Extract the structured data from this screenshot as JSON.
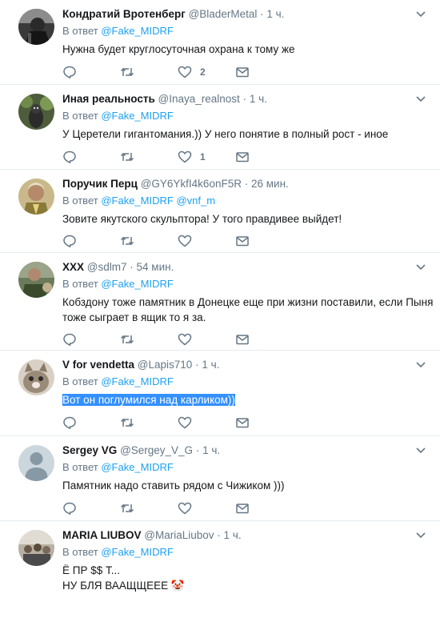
{
  "reply_prefix": "В ответ",
  "dot": "·",
  "tweets": [
    {
      "name": "Кондратий Вротенберг",
      "handle": "@BladerMetal",
      "time": "1 ч.",
      "reply_to": [
        "@Fake_MIDRF"
      ],
      "text": [
        "Нужна будет круглосуточная охрана к тому же"
      ],
      "likes": "2"
    },
    {
      "name": "Иная реальность",
      "handle": "@Inaya_realnost",
      "time": "1 ч.",
      "reply_to": [
        "@Fake_MIDRF"
      ],
      "text": [
        "У Церетели гигантомания.)) У него понятие в полный рост - иное"
      ],
      "likes": "1"
    },
    {
      "name": "Поручик Перц",
      "handle": "@GY6YkfI4k6onF5R",
      "time": "26 мин.",
      "reply_to": [
        "@Fake_MIDRF",
        "@vnf_m"
      ],
      "text": [
        "Зовите якутского скульптора! У того правдивее выйдет!"
      ],
      "likes": ""
    },
    {
      "name": "XXX",
      "handle": "@sdlm7",
      "time": "54 мин.",
      "reply_to": [
        "@Fake_MIDRF"
      ],
      "text": [
        "Кобздону тоже памятник в Донецке еще при жизни поставили, если Пыня",
        "тоже сыграет в ящик то я за."
      ],
      "likes": ""
    },
    {
      "name": "V for vendetta",
      "handle": "@Lapis710",
      "time": "1 ч.",
      "reply_to": [
        "@Fake_MIDRF"
      ],
      "text": [
        "Вот он поглумился над карликом))"
      ],
      "likes": ""
    },
    {
      "name": "Sergey VG",
      "handle": "@Sergey_V_G",
      "time": "1 ч.",
      "reply_to": [
        "@Fake_MIDRF"
      ],
      "text": [
        "Памятник надо ставить рядом с Чижиком )))"
      ],
      "likes": ""
    },
    {
      "name": "MARIA LIUBOV",
      "handle": "@MariaLiubov",
      "time": "1 ч.",
      "reply_to": [
        "@Fake_MIDRF"
      ],
      "text": [
        "Ё ПР $$ Т...",
        "НУ БЛЯ ВААЩЩЕЕЕ 🤡"
      ],
      "likes": ""
    }
  ],
  "icons": {
    "reply": "reply-icon",
    "retweet": "retweet-icon",
    "like": "heart-icon",
    "dm": "envelope-icon",
    "caret": "chevron-down-icon"
  },
  "colors": {
    "link": "#1da1f2",
    "secondary": "#657786",
    "divider": "#e6ecf0",
    "selection": "#3390ff"
  }
}
